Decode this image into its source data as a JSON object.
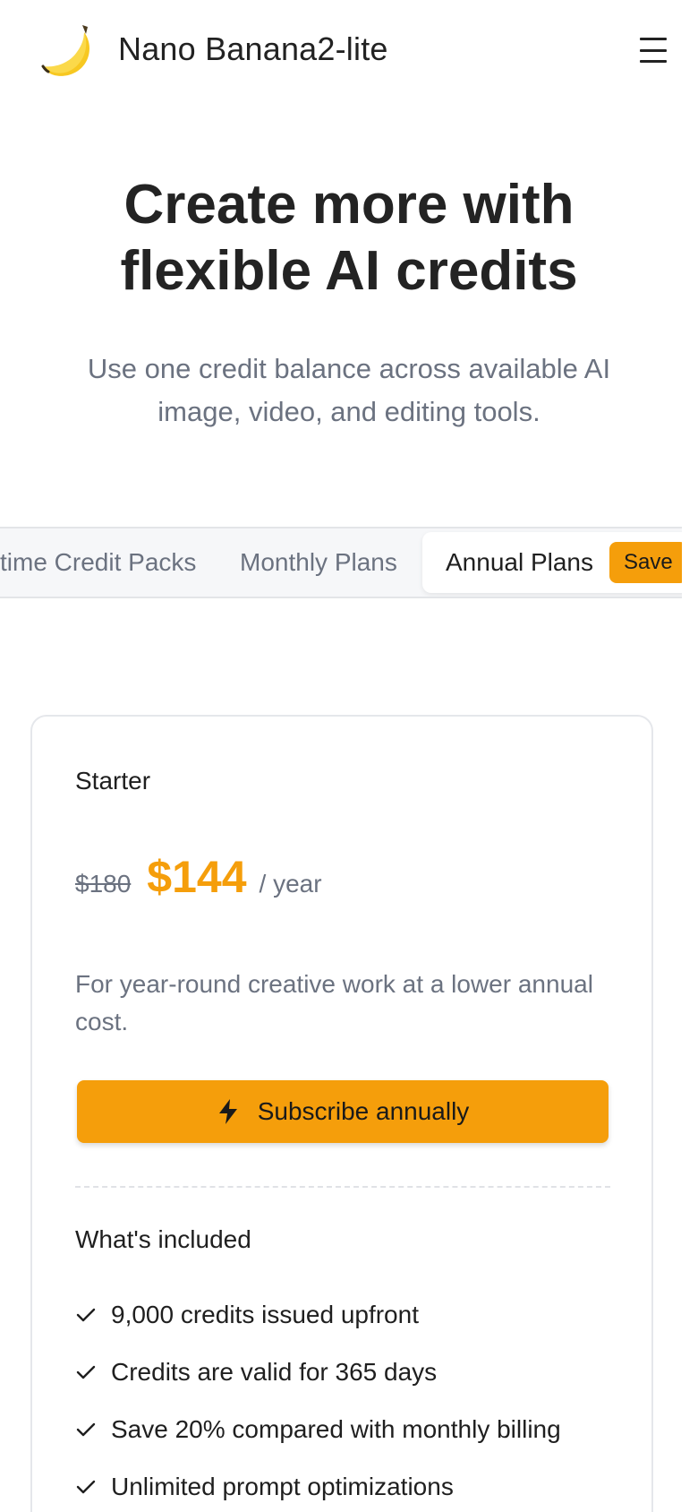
{
  "header": {
    "brand": "Nano Banana2-lite",
    "logo_icon": "banana-icon",
    "menu_icon": "hamburger-menu-icon"
  },
  "hero": {
    "title_line1": "Create more with",
    "title_line2": "flexible AI credits",
    "subtitle": "Use one credit balance across available AI image, video, and editing tools."
  },
  "tabs": {
    "items": [
      {
        "label": "One-time Credit Packs",
        "visible_label": "time Credit Packs",
        "active": false
      },
      {
        "label": "Monthly Plans",
        "active": false
      },
      {
        "label": "Annual Plans",
        "active": true,
        "badge": "Save"
      }
    ]
  },
  "plan": {
    "name": "Starter",
    "old_price": "$180",
    "price": "$144",
    "period": "/ year",
    "description": "For year-round creative work at a lower annual cost.",
    "cta_label": "Subscribe annually",
    "cta_icon": "lightning-bolt-icon",
    "included_title": "What's included",
    "features": [
      "9,000 credits issued upfront",
      "Credits are valid for 365 days",
      "Save 20% compared with monthly billing",
      "Unlimited prompt optimizations"
    ]
  },
  "colors": {
    "accent": "#f59e0b",
    "text_muted": "#6b7280",
    "text_primary": "#1f1f1f",
    "border": "#e5e7eb"
  }
}
